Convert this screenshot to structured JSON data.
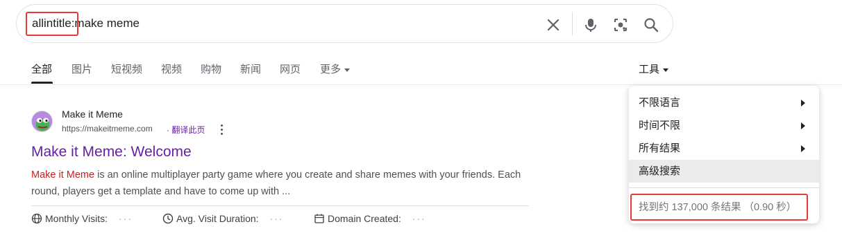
{
  "search": {
    "query_operator": "allintitle:",
    "query_terms": "make meme",
    "icons": [
      "close-icon",
      "mic-icon",
      "lens-icon",
      "search-icon"
    ]
  },
  "tabs": {
    "items": [
      {
        "label": "全部",
        "active": true
      },
      {
        "label": "图片"
      },
      {
        "label": "短视频"
      },
      {
        "label": "视频"
      },
      {
        "label": "购物"
      },
      {
        "label": "新闻"
      },
      {
        "label": "网页"
      },
      {
        "label": "更多"
      }
    ],
    "tools_label": "工具"
  },
  "tools_menu": {
    "items": [
      {
        "label": "不限语言",
        "has_submenu": true
      },
      {
        "label": "时间不限",
        "has_submenu": true
      },
      {
        "label": "所有结果",
        "has_submenu": true
      },
      {
        "label": "高级搜索",
        "has_submenu": false,
        "highlighted": true
      }
    ],
    "result_stats": "找到约 137,000 条结果 （0.90 秒）"
  },
  "result": {
    "site_name": "Make it Meme",
    "url": "https://makeitmeme.com",
    "translate_label": "· 翻译此页",
    "title": "Make it Meme: Welcome",
    "snippet_highlight": "Make it Meme",
    "snippet_rest": " is an online multiplayer party game where you create and share memes with your friends. Each round, players get a template and have to come up with ...",
    "metrics": [
      {
        "label": "Monthly Visits:",
        "value": "···",
        "icon": "globe-icon"
      },
      {
        "label": "Avg. Visit Duration:",
        "value": "···",
        "icon": "clock-icon"
      },
      {
        "label": "Domain Created:",
        "value": "···",
        "icon": "calendar-icon"
      }
    ]
  },
  "colors": {
    "visited_link": "#681da8",
    "highlight_box": "#e53935",
    "snippet_emphasis": "#c5221f"
  }
}
